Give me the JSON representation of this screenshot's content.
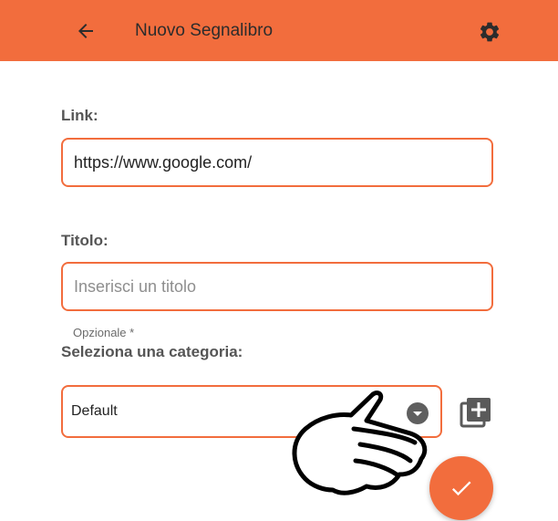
{
  "appbar": {
    "title": "Nuovo Segnalibro",
    "back_icon": "arrow-back-icon",
    "settings_icon": "gear-icon"
  },
  "form": {
    "link": {
      "label": "Link:",
      "value": "https://www.google.com/"
    },
    "title": {
      "label": "Titolo:",
      "placeholder": "Inserisci un titolo",
      "helper": "Opzionale *"
    },
    "category": {
      "label": "Seleziona una categoria:",
      "selected": "Default",
      "add_icon": "add-category-icon"
    }
  },
  "fab": {
    "icon": "check-icon"
  },
  "colors": {
    "accent": "#f26d3d",
    "text": "#2c2c2c"
  }
}
